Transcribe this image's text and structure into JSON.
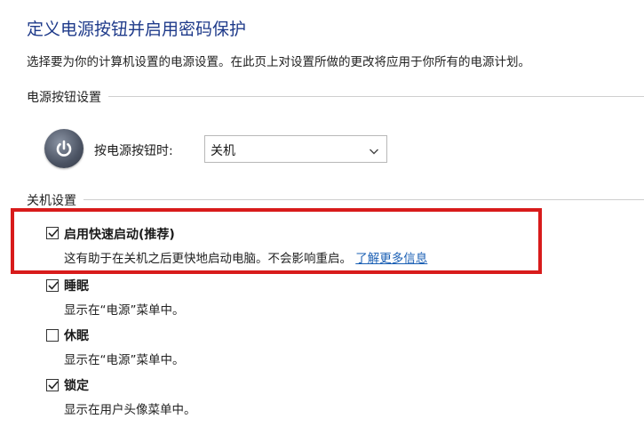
{
  "page": {
    "title": "定义电源按钮并启用密码保护",
    "subtitle": "选择要为你的计算机设置的电源设置。在此页上对设置所做的更改将应用于你所有的电源计划。"
  },
  "power_button_section": {
    "label": "电源按钮设置",
    "row_label": "按电源按钮时:",
    "selected_option": "关机"
  },
  "shutdown_section": {
    "label": "关机设置",
    "options": [
      {
        "title": "启用快速启动(推荐)",
        "desc": "这有助于在关机之后更快地启动电脑。不会影响重启。",
        "link": "了解更多信息",
        "checked": true
      },
      {
        "title": "睡眠",
        "desc": "显示在“电源”菜单中。",
        "checked": true
      },
      {
        "title": "休眠",
        "desc": "显示在“电源”菜单中。",
        "checked": false
      },
      {
        "title": "锁定",
        "desc": "显示在用户头像菜单中。",
        "checked": true
      }
    ]
  },
  "icons": {
    "power": "power-icon",
    "chevron": "chevron-down-icon",
    "check": "checkmark-icon"
  },
  "colors": {
    "title": "#1e3a8a",
    "highlight_border": "#d81b1b",
    "link": "#1a5fb4"
  }
}
